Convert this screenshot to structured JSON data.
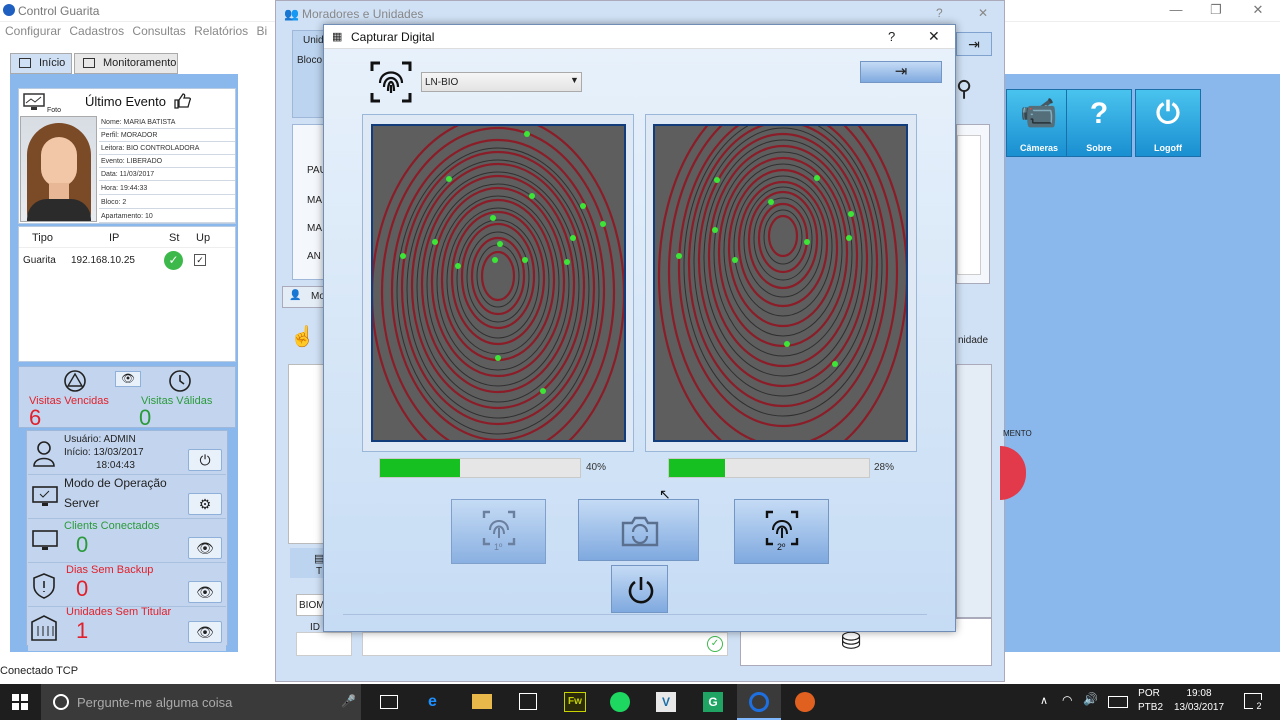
{
  "app": {
    "title": "Control Guarita",
    "menu": [
      "Configurar",
      "Cadastros",
      "Consultas",
      "Relatórios",
      "Bi"
    ],
    "tabs": [
      "Início",
      "Monitoramento"
    ],
    "status": "Conectado TCP"
  },
  "event": {
    "header": "Último Evento",
    "photo_label": "Foto",
    "lines": [
      "Nome: MARIA BATISTA",
      "Perfil: MORADOR",
      "Leitora: BIO CONTROLADORA",
      "Evento: LIBERADO",
      "Data: 11/03/2017",
      "Hora: 19:44:33",
      "Bloco: 2",
      "Apartamento: 10"
    ]
  },
  "devices": {
    "headers": [
      "Tipo",
      "IP",
      "St",
      "Up"
    ],
    "rows": [
      {
        "tipo": "Guarita",
        "ip": "192.168.10.25"
      }
    ]
  },
  "visits": {
    "expired_label": "Visitas Vencidas",
    "expired": "6",
    "valid_label": "Visitas Válidas",
    "valid": "0"
  },
  "session": {
    "user": "Usuário: ADMIN",
    "start": "Início: 13/03/2017",
    "time": "18:04:43",
    "mode_label": "Modo de Operação",
    "mode": "Server",
    "clients_label": "Clients Conectados",
    "clients": "0",
    "backup_label": "Dias Sem Backup",
    "backup": "0",
    "units_label": "Unidades Sem Titular",
    "units": "1"
  },
  "moradores": {
    "title": "Moradores e Unidades",
    "left_frag": [
      "Unid",
      "Bloco"
    ],
    "list_frag": [
      "PAU",
      "MA",
      "MA",
      "AN"
    ],
    "tab_frag": "Mo",
    "unidade_frag": "nidade",
    "mento_frag": "MENTO",
    "t_frag": "T",
    "biom_frag": "BIOM",
    "id_frag": "ID"
  },
  "tiles": [
    {
      "label": "Câmeras"
    },
    {
      "label": "Sobre"
    },
    {
      "label": "Logoff"
    }
  ],
  "dialog": {
    "title": "Capturar Digital",
    "help": "?",
    "close": "✕",
    "device": "LN-BIO",
    "progress": [
      {
        "value": 40,
        "label": "40%"
      },
      {
        "value": 28,
        "label": "28%"
      }
    ],
    "btn1_sub": "1º",
    "btn2_sub": "2º"
  },
  "taskbar": {
    "search": "Pergunte-me alguma coisa",
    "lang1": "POR",
    "lang2": "PTB2",
    "time": "19:08",
    "date": "13/03/2017",
    "notif": "2"
  },
  "colors": {
    "panel": "#8bb8ec",
    "tile": "#1a8fd1",
    "green": "#16c020",
    "red": "#e0202b"
  }
}
